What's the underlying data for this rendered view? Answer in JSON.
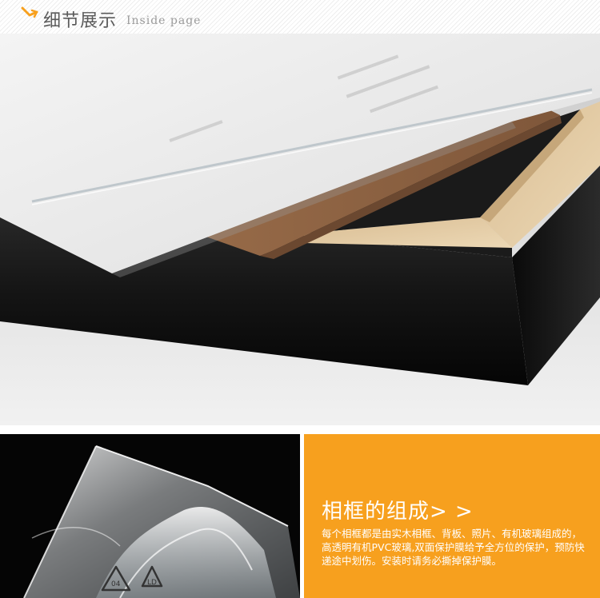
{
  "header": {
    "title": "细节展示",
    "subtitle": "Inside page",
    "icon": "chevron-down-right-icon",
    "accent_color": "#f7a01e"
  },
  "main_photo": {
    "subject": "frame-corner-detail-photo",
    "frame_color": "#111111",
    "wood_color": "#e2c9a1",
    "backboard_color": "#8f6543"
  },
  "film_photo": {
    "subject": "pvc-film-photo",
    "recycle_code": "04",
    "recycle_text": "LD"
  },
  "info": {
    "title": "相框的组成> >",
    "body": "每个相框都是由实木相框、背板、照片、有机玻璃组成的，高透明有机PVC玻璃,双面保护膜给予全方位的保护，预防快递途中划伤。安装时请务必撕掉保护膜。",
    "panel_color": "#f7a01e"
  }
}
